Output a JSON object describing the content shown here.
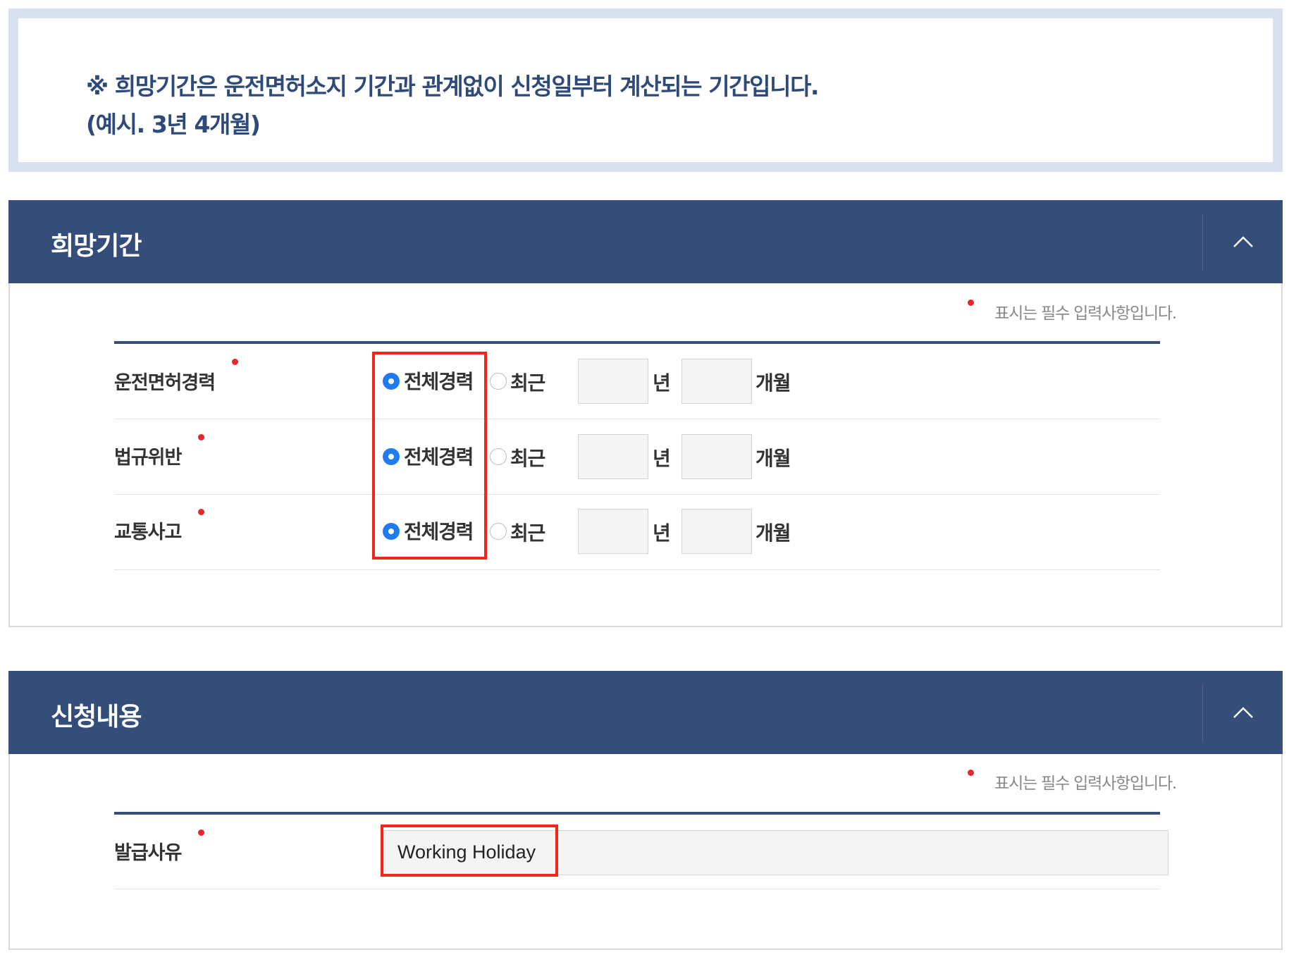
{
  "notice": {
    "line1": "※ 희망기간은 운전면허소지 기간과 관계없이 신청일부터 계산되는 기간입니다.",
    "line2": "(예시. 3년 4개월)"
  },
  "period_section": {
    "title": "희망기간",
    "toggle_icon": "chevron-up-icon",
    "required_note": "표시는 필수 입력사항입니다.",
    "rows": [
      {
        "label": "운전면허경력",
        "option_all": "전체경력",
        "option_recent": "최근",
        "selected": "전체경력",
        "years": "",
        "months": "",
        "unit_year": "년",
        "unit_month": "개월"
      },
      {
        "label": "법규위반",
        "option_all": "전체경력",
        "option_recent": "최근",
        "selected": "전체경력",
        "years": "",
        "months": "",
        "unit_year": "년",
        "unit_month": "개월"
      },
      {
        "label": "교통사고",
        "option_all": "전체경력",
        "option_recent": "최근",
        "selected": "전체경력",
        "years": "",
        "months": "",
        "unit_year": "년",
        "unit_month": "개월"
      }
    ]
  },
  "application_section": {
    "title": "신청내용",
    "toggle_icon": "chevron-up-icon",
    "required_note": "표시는 필수 입력사항입니다.",
    "reason_label": "발급사유",
    "reason_value": "Working Holiday"
  },
  "colors": {
    "header_bg": "#344d79",
    "notice_border": "#d7e0ef",
    "notice_text": "#2e4a7a",
    "radio_selected": "#1e7bf0",
    "required_dot": "#e8262a",
    "highlight_box": "#f0281c"
  }
}
